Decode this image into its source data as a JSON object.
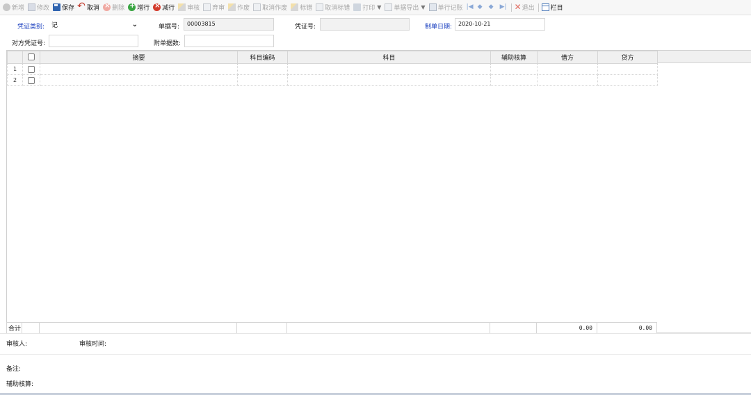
{
  "toolbar": {
    "items": [
      {
        "label": "新增",
        "icon": "add-circle-icon",
        "enabled": false
      },
      {
        "label": "修改",
        "icon": "edit-doc-icon",
        "enabled": false
      },
      {
        "label": "保存",
        "icon": "save-disk-icon",
        "enabled": true
      },
      {
        "label": "取消",
        "icon": "undo-arrow-icon",
        "enabled": true
      },
      {
        "label": "删除",
        "icon": "delete-circle-icon",
        "enabled": false
      },
      {
        "label": "增行",
        "icon": "add-row-icon",
        "enabled": true
      },
      {
        "label": "减行",
        "icon": "remove-row-icon",
        "enabled": true
      },
      {
        "label": "审核",
        "icon": "audit-pencil-icon",
        "enabled": false
      },
      {
        "label": "弃审",
        "icon": "unaudit-page-icon",
        "enabled": false
      },
      {
        "label": "作废",
        "icon": "void-pencil-icon",
        "enabled": false
      },
      {
        "label": "取消作废",
        "icon": "unvoid-page-icon",
        "enabled": false
      },
      {
        "label": "标错",
        "icon": "mark-error-pencil-icon",
        "enabled": false
      },
      {
        "label": "取消标错",
        "icon": "unmark-error-page-icon",
        "enabled": false
      },
      {
        "label": "打印",
        "icon": "printer-icon",
        "enabled": false,
        "dropdown": true
      },
      {
        "label": "单据导出",
        "icon": "export-icon",
        "enabled": false,
        "dropdown": true
      },
      {
        "label": "单行记账",
        "icon": "ledger-grid-icon",
        "enabled": false
      },
      {
        "label": "退出",
        "icon": "exit-x-icon",
        "enabled": false
      },
      {
        "label": "栏目",
        "icon": "columns-grid-icon",
        "enabled": true
      }
    ]
  },
  "form": {
    "voucher_type_label": "凭证类别:",
    "voucher_type_value": "记",
    "bill_no_label": "单据号:",
    "bill_no_value": "00003815",
    "voucher_no_label": "凭证号:",
    "voucher_no_value": "",
    "date_label": "制单日期:",
    "date_value": "2020-10-21",
    "counter_voucher_label": "对方凭证号:",
    "counter_voucher_value": "",
    "attachments_label": "附单据数:",
    "attachments_value": ""
  },
  "grid": {
    "columns": [
      "摘要",
      "科目编码",
      "科目",
      "辅助核算",
      "借方",
      "贷方"
    ],
    "rows": [
      {
        "index": "1",
        "summary": "",
        "code": "",
        "account": "",
        "aux": "",
        "debit": "",
        "credit": ""
      },
      {
        "index": "2",
        "summary": "",
        "code": "",
        "account": "",
        "aux": "",
        "debit": "",
        "credit": ""
      }
    ],
    "total_label": "合计",
    "total_debit": "0.00",
    "total_credit": "0.00"
  },
  "bottom": {
    "auditor_label": "审核人:",
    "audit_time_label": "审核时间:",
    "remark_label": "备注:",
    "aux_label": "辅助核算:"
  },
  "colors": {
    "blue_label": "#1a3fbf",
    "toolbar_bg": "#f7f7f7",
    "header_bg": "#f0f0f0"
  }
}
